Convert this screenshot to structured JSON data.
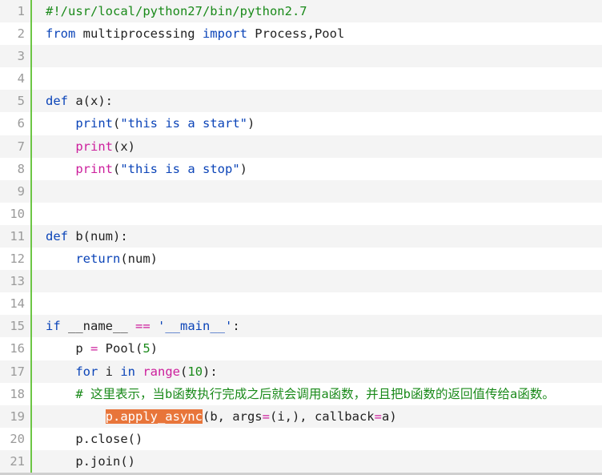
{
  "editor": {
    "lines": [
      {
        "num": "1",
        "indent": "",
        "tokens": [
          {
            "t": "#!/usr/local/python27/bin/python2.7",
            "c": "tok-c"
          }
        ]
      },
      {
        "num": "2",
        "indent": "",
        "tokens": [
          {
            "t": "from",
            "c": "tok-k"
          },
          {
            "t": " multiprocessing ",
            "c": "tok-t"
          },
          {
            "t": "import",
            "c": "tok-k"
          },
          {
            "t": " Process,Pool",
            "c": "tok-t"
          }
        ]
      },
      {
        "num": "3",
        "indent": "",
        "tokens": []
      },
      {
        "num": "4",
        "indent": "",
        "tokens": []
      },
      {
        "num": "5",
        "indent": "",
        "tokens": [
          {
            "t": "def",
            "c": "tok-k"
          },
          {
            "t": " a(x):",
            "c": "tok-t"
          }
        ]
      },
      {
        "num": "6",
        "indent": "    ",
        "tokens": [
          {
            "t": "print",
            "c": "tok-k"
          },
          {
            "t": "(",
            "c": "tok-t"
          },
          {
            "t": "\"this is a start\"",
            "c": "tok-s"
          },
          {
            "t": ")",
            "c": "tok-t"
          }
        ]
      },
      {
        "num": "7",
        "indent": "    ",
        "tokens": [
          {
            "t": "print",
            "c": "tok-b"
          },
          {
            "t": "(x)",
            "c": "tok-t"
          }
        ]
      },
      {
        "num": "8",
        "indent": "    ",
        "tokens": [
          {
            "t": "print",
            "c": "tok-b"
          },
          {
            "t": "(",
            "c": "tok-t"
          },
          {
            "t": "\"this is a stop\"",
            "c": "tok-s"
          },
          {
            "t": ")",
            "c": "tok-t"
          }
        ]
      },
      {
        "num": "9",
        "indent": "",
        "tokens": []
      },
      {
        "num": "10",
        "indent": "",
        "tokens": []
      },
      {
        "num": "11",
        "indent": "",
        "tokens": [
          {
            "t": "def",
            "c": "tok-k"
          },
          {
            "t": " b(num):",
            "c": "tok-t"
          }
        ]
      },
      {
        "num": "12",
        "indent": "    ",
        "tokens": [
          {
            "t": "return",
            "c": "tok-k"
          },
          {
            "t": "(num)",
            "c": "tok-t"
          }
        ]
      },
      {
        "num": "13",
        "indent": "",
        "tokens": []
      },
      {
        "num": "14",
        "indent": "",
        "tokens": []
      },
      {
        "num": "15",
        "indent": "",
        "tokens": [
          {
            "t": "if",
            "c": "tok-k"
          },
          {
            "t": " __name__ ",
            "c": "tok-t"
          },
          {
            "t": "==",
            "c": "tok-b"
          },
          {
            "t": " ",
            "c": "tok-t"
          },
          {
            "t": "'__main__'",
            "c": "tok-s"
          },
          {
            "t": ":",
            "c": "tok-t"
          }
        ]
      },
      {
        "num": "16",
        "indent": "    ",
        "tokens": [
          {
            "t": "p ",
            "c": "tok-t"
          },
          {
            "t": "=",
            "c": "tok-b"
          },
          {
            "t": " Pool(",
            "c": "tok-t"
          },
          {
            "t": "5",
            "c": "tok-n"
          },
          {
            "t": ")",
            "c": "tok-t"
          }
        ]
      },
      {
        "num": "17",
        "indent": "    ",
        "tokens": [
          {
            "t": "for",
            "c": "tok-k"
          },
          {
            "t": " i ",
            "c": "tok-t"
          },
          {
            "t": "in",
            "c": "tok-k"
          },
          {
            "t": " ",
            "c": "tok-t"
          },
          {
            "t": "range",
            "c": "tok-b"
          },
          {
            "t": "(",
            "c": "tok-t"
          },
          {
            "t": "10",
            "c": "tok-n"
          },
          {
            "t": "):",
            "c": "tok-t"
          }
        ]
      },
      {
        "num": "18",
        "indent": "    ",
        "tokens": [
          {
            "t": "# 这里表示，当b函数执行完成之后就会调用a函数，并且把b函数的返回值传给a函数。",
            "c": "tok-c cmt"
          }
        ]
      },
      {
        "num": "19",
        "indent": "        ",
        "tokens": [
          {
            "t": "p.apply_async",
            "c": "tok-hl"
          },
          {
            "t": "(b, args",
            "c": "tok-t"
          },
          {
            "t": "=",
            "c": "tok-b"
          },
          {
            "t": "(i,), callback",
            "c": "tok-t"
          },
          {
            "t": "=",
            "c": "tok-b"
          },
          {
            "t": "a)",
            "c": "tok-t"
          }
        ]
      },
      {
        "num": "20",
        "indent": "    ",
        "tokens": [
          {
            "t": "p.close()",
            "c": "tok-t"
          }
        ]
      },
      {
        "num": "21",
        "indent": "    ",
        "tokens": [
          {
            "t": "p.join()",
            "c": "tok-t"
          }
        ]
      }
    ]
  }
}
